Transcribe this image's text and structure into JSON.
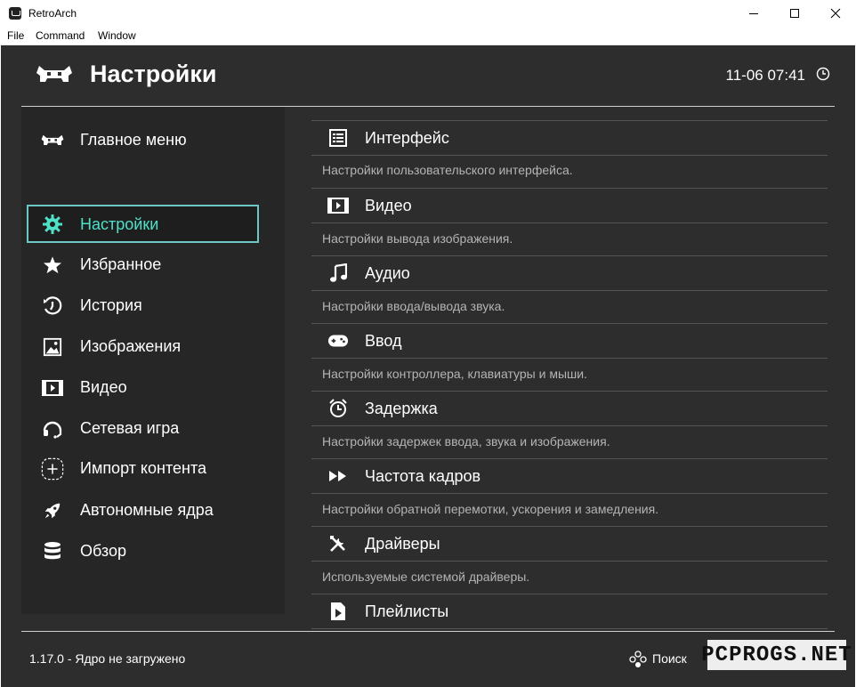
{
  "window": {
    "title": "RetroArch",
    "menu": [
      "File",
      "Command",
      "Window"
    ]
  },
  "header": {
    "title": "Настройки",
    "clock": "11-06 07:41"
  },
  "colors": {
    "background": "#2d2d2d",
    "sidebar": "#262626",
    "accent": "#4fe0c8",
    "selection_border": "#6ec6c6"
  },
  "sidebar": {
    "items": [
      {
        "label": "Главное меню",
        "icon": "retroarch-logo-icon"
      },
      {
        "label": "Настройки",
        "icon": "gear-icon",
        "active": true
      },
      {
        "label": "Избранное",
        "icon": "star-icon"
      },
      {
        "label": "История",
        "icon": "history-icon"
      },
      {
        "label": "Изображения",
        "icon": "image-icon"
      },
      {
        "label": "Видео",
        "icon": "film-icon"
      },
      {
        "label": "Сетевая игра",
        "icon": "headset-icon"
      },
      {
        "label": "Импорт контента",
        "icon": "plus-icon"
      },
      {
        "label": "Автономные ядра",
        "icon": "rocket-icon"
      },
      {
        "label": "Обзор",
        "icon": "database-icon"
      }
    ]
  },
  "content": {
    "items": [
      {
        "label": "Интерфейс",
        "desc": "Настройки пользовательского интерфейса.",
        "icon": "list-icon"
      },
      {
        "label": "Видео",
        "desc": "Настройки вывода изображения.",
        "icon": "film-icon"
      },
      {
        "label": "Аудио",
        "desc": "Настройки ввода/вывода звука.",
        "icon": "music-icon"
      },
      {
        "label": "Ввод",
        "desc": "Настройки контроллера, клавиатуры и мыши.",
        "icon": "gamepad-icon"
      },
      {
        "label": "Задержка",
        "desc": "Настройки задержек ввода, звука и изображения.",
        "icon": "alarm-clock-icon"
      },
      {
        "label": "Частота кадров",
        "desc": "Настройки обратной перемотки, ускорения и замедления.",
        "icon": "fast-forward-icon"
      },
      {
        "label": "Драйверы",
        "desc": "Используемые системой драйверы.",
        "icon": "tools-icon"
      },
      {
        "label": "Плейлисты",
        "desc": "",
        "icon": "playlist-file-icon"
      }
    ]
  },
  "footer": {
    "status": "1.17.0 - Ядро не загружено",
    "search": "Поиск"
  },
  "watermark": "PCPROGS.NET"
}
